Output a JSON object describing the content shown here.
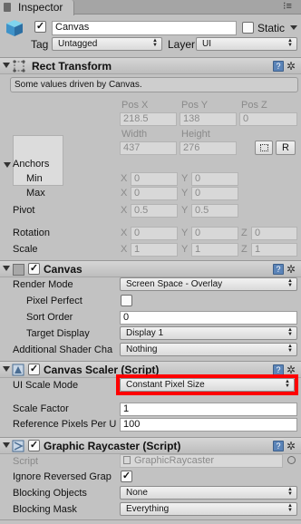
{
  "window": {
    "tab_title": "Inspector"
  },
  "header": {
    "object_name": "Canvas",
    "static_label": "Static",
    "tag_label": "Tag",
    "tag_value": "Untagged",
    "layer_label": "Layer",
    "layer_value": "UI"
  },
  "rect_transform": {
    "title": "Rect Transform",
    "info": "Some values driven by Canvas.",
    "pos_x_label": "Pos X",
    "pos_y_label": "Pos Y",
    "pos_z_label": "Pos Z",
    "pos_x": "218.5",
    "pos_y": "138",
    "pos_z": "0",
    "width_label": "Width",
    "height_label": "Height",
    "width": "437",
    "height": "276",
    "r_button": "R",
    "anchors_label": "Anchors",
    "min_label": "Min",
    "max_label": "Max",
    "min_x": "0",
    "min_y": "0",
    "max_x": "0",
    "max_y": "0",
    "pivot_label": "Pivot",
    "pivot_x": "0.5",
    "pivot_y": "0.5",
    "rotation_label": "Rotation",
    "rot_x": "0",
    "rot_y": "0",
    "rot_z": "0",
    "scale_label": "Scale",
    "scale_x": "1",
    "scale_y": "1",
    "scale_z": "1",
    "x": "X",
    "y": "Y",
    "z": "Z"
  },
  "canvas": {
    "title": "Canvas",
    "render_mode_label": "Render Mode",
    "render_mode_value": "Screen Space - Overlay",
    "pixel_perfect_label": "Pixel Perfect",
    "sort_order_label": "Sort Order",
    "sort_order_value": "0",
    "target_display_label": "Target Display",
    "target_display_value": "Display 1",
    "shader_channels_label": "Additional Shader Cha",
    "shader_channels_value": "Nothing"
  },
  "canvas_scaler": {
    "title": "Canvas Scaler (Script)",
    "ui_scale_mode_label": "UI Scale Mode",
    "ui_scale_mode_value": "Constant Pixel Size",
    "scale_factor_label": "Scale Factor",
    "scale_factor_value": "1",
    "ref_pixels_label": "Reference Pixels Per U",
    "ref_pixels_value": "100",
    "highlight_color": "#ff0000"
  },
  "graphic_raycaster": {
    "title": "Graphic Raycaster (Script)",
    "script_label": "Script",
    "script_value": "GraphicRaycaster",
    "ignore_reversed_label": "Ignore Reversed Grap",
    "blocking_objects_label": "Blocking Objects",
    "blocking_objects_value": "None",
    "blocking_mask_label": "Blocking Mask",
    "blocking_mask_value": "Everything"
  },
  "icons": {
    "tab": "inspector-icon",
    "object": "gameobject-cube-icon",
    "rect": "rect-transform-icon",
    "help": "help-book-icon",
    "gear": "gear-icon",
    "check": "checkmark-icon"
  }
}
